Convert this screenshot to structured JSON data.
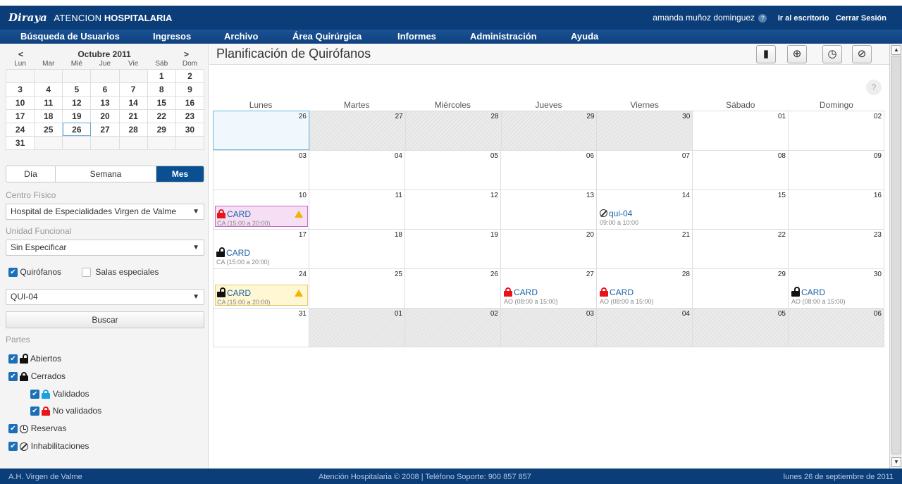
{
  "header": {
    "logo": "Diraya",
    "app_name_prefix": "ATENCION",
    "app_name_main": "HOSPITALARIA",
    "user_name": "amanda muñoz dominguez",
    "help_label": "(?)",
    "desktop_link": "Ir al escritorio",
    "logout_link": "Cerrar Sesión"
  },
  "menu": {
    "items": [
      "Búsqueda de Usuarios",
      "Ingresos",
      "Archivo",
      "Área Quirúrgica",
      "Informes",
      "Administración",
      "Ayuda"
    ]
  },
  "mini_calendar": {
    "month_title": "Octubre 2011",
    "prev": "<",
    "next": ">",
    "weekdays": [
      "Lun",
      "Mar",
      "Mié",
      "Jue",
      "Vie",
      "Sáb",
      "Dom"
    ],
    "weeks": [
      [
        "",
        "",
        "",
        "",
        "",
        "1",
        "2"
      ],
      [
        "3",
        "4",
        "5",
        "6",
        "7",
        "8",
        "9"
      ],
      [
        "10",
        "11",
        "12",
        "13",
        "14",
        "15",
        "16"
      ],
      [
        "17",
        "18",
        "19",
        "20",
        "21",
        "22",
        "23"
      ],
      [
        "24",
        "25",
        "26",
        "27",
        "28",
        "29",
        "30"
      ],
      [
        "31",
        "",
        "",
        "",
        "",
        "",
        ""
      ]
    ],
    "today": "26"
  },
  "view_tabs": {
    "day": "Día",
    "week": "Semana",
    "month": "Mes",
    "active": "month"
  },
  "filters": {
    "centro_label": "Centro Físico",
    "centro_value": "Hospital de Especialidades Virgen de Valme",
    "unidad_label": "Unidad Funcional",
    "unidad_value": "Sin Especificar",
    "quirofanos_label": "Quirófanos",
    "quirofanos_checked": true,
    "salas_label": "Salas especiales",
    "salas_checked": false,
    "sala_value": "QUI-04",
    "search_button": "Buscar"
  },
  "partes": {
    "label": "Partes",
    "abiertos": "Abiertos",
    "cerrados": "Cerrados",
    "validados": "Validados",
    "no_validados": "No validados",
    "reservas": "Reservas",
    "inhabilitaciones": "Inhabilitaciones"
  },
  "main": {
    "title": "Planificación de Quirófanos",
    "help": "?",
    "weekdays": [
      "Lunes",
      "Martes",
      "Miércoles",
      "Jueves",
      "Viernes",
      "Sábado",
      "Domingo"
    ],
    "weeks": [
      {
        "days": [
          "26",
          "27",
          "28",
          "29",
          "30",
          "01",
          "02"
        ],
        "gray": [
          false,
          true,
          true,
          true,
          true,
          false,
          false
        ],
        "selected": 0
      },
      {
        "days": [
          "03",
          "04",
          "05",
          "06",
          "07",
          "08",
          "09"
        ],
        "gray": [
          false,
          false,
          false,
          false,
          false,
          false,
          false
        ]
      },
      {
        "days": [
          "10",
          "11",
          "12",
          "13",
          "14",
          "15",
          "16"
        ],
        "gray": [
          false,
          false,
          false,
          false,
          false,
          false,
          false
        ]
      },
      {
        "days": [
          "17",
          "18",
          "19",
          "20",
          "21",
          "22",
          "23"
        ],
        "gray": [
          false,
          false,
          false,
          false,
          false,
          false,
          false
        ]
      },
      {
        "days": [
          "24",
          "25",
          "26",
          "27",
          "28",
          "29",
          "30"
        ],
        "gray": [
          false,
          false,
          false,
          false,
          false,
          false,
          false
        ]
      },
      {
        "days": [
          "31",
          "01",
          "02",
          "03",
          "04",
          "05",
          "06"
        ],
        "gray": [
          false,
          true,
          true,
          true,
          true,
          true,
          true
        ]
      }
    ],
    "events": [
      {
        "week": 2,
        "day": 0,
        "type": "closed-red",
        "name": "CARD",
        "time": "CA (15:00 a 20:00)",
        "style": "pink",
        "warning": true
      },
      {
        "week": 2,
        "day": 4,
        "type": "ban",
        "name": "qui-04",
        "time": "09:00 a 10:00",
        "style": "none",
        "warning": false
      },
      {
        "week": 3,
        "day": 0,
        "type": "open",
        "name": "CARD",
        "time": "CA (15:00 a 20:00)",
        "style": "none",
        "warning": false
      },
      {
        "week": 4,
        "day": 0,
        "type": "open",
        "name": "CARD",
        "time": "CA (15:00 a 20:00)",
        "style": "yellow",
        "warning": true
      },
      {
        "week": 4,
        "day": 3,
        "type": "closed-red",
        "name": "CARD",
        "time": "AO (08:00 a 15:00)",
        "style": "none",
        "warning": false
      },
      {
        "week": 4,
        "day": 4,
        "type": "closed-red",
        "name": "CARD",
        "time": "AO (08:00 a 15:00)",
        "style": "none",
        "warning": false
      },
      {
        "week": 4,
        "day": 6,
        "type": "open",
        "name": "CARD",
        "time": "AO (08:00 a 15:00)",
        "style": "none",
        "warning": false
      }
    ]
  },
  "footer": {
    "left": "A.H. Virgen de Valme",
    "center": "Atención Hospitalaria © 2008 | Teléfono Soporte: 900 857 857",
    "right": "lunes 26 de septiembre de 2011"
  },
  "colors": {
    "brand": "#0b3d78",
    "accent": "#0b4f93",
    "lock_red": "#e8141b",
    "lock_blue": "#1aa0e0",
    "event_link": "#1a63a4"
  }
}
